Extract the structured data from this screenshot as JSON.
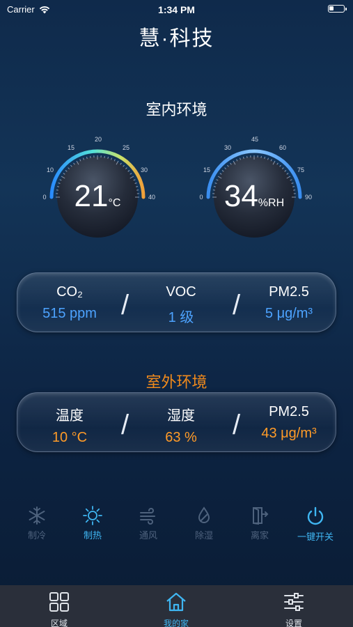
{
  "status_bar": {
    "carrier": "Carrier",
    "time": "1:34 PM"
  },
  "app_title": "慧·科技",
  "indoor": {
    "title": "室内环境",
    "temperature": {
      "value": "21",
      "unit": "°C",
      "ticks": [
        "0",
        "10",
        "15",
        "20",
        "25",
        "30",
        "40"
      ]
    },
    "humidity": {
      "value": "34",
      "unit": "%RH",
      "ticks": [
        "0",
        "15",
        "30",
        "45",
        "60",
        "75",
        "90"
      ]
    },
    "metrics": [
      {
        "label": "CO₂",
        "value": "515 ppm"
      },
      {
        "label": "VOC",
        "value": "1 级"
      },
      {
        "label": "PM2.5",
        "value": "5 μg/m³"
      }
    ]
  },
  "outdoor": {
    "title": "室外环境",
    "metrics": [
      {
        "label": "温度",
        "value": "10 °C"
      },
      {
        "label": "湿度",
        "value": "63 %"
      },
      {
        "label": "PM2.5",
        "value": "43 μg/m³"
      }
    ]
  },
  "separator": "/",
  "modes": [
    {
      "label": "制冷",
      "icon": "snowflake-icon",
      "state": "inactive"
    },
    {
      "label": "制热",
      "icon": "sun-icon",
      "state": "active"
    },
    {
      "label": "通风",
      "icon": "wind-icon",
      "state": "inactive"
    },
    {
      "label": "除湿",
      "icon": "droplet-icon",
      "state": "inactive"
    },
    {
      "label": "离家",
      "icon": "door-exit-icon",
      "state": "inactive"
    },
    {
      "label": "一键开关",
      "icon": "power-icon",
      "state": "active"
    }
  ],
  "tabs": [
    {
      "label": "区域",
      "icon": "grid-icon",
      "state": "inactive"
    },
    {
      "label": "我的家",
      "icon": "home-icon",
      "state": "active"
    },
    {
      "label": "设置",
      "icon": "sliders-icon",
      "state": "inactive"
    }
  ],
  "colors": {
    "accent_blue": "#3fb6f2",
    "indoor_value": "#4da3ff",
    "outdoor_value": "#ff9b28",
    "outdoor_title": "#f08a1c"
  }
}
